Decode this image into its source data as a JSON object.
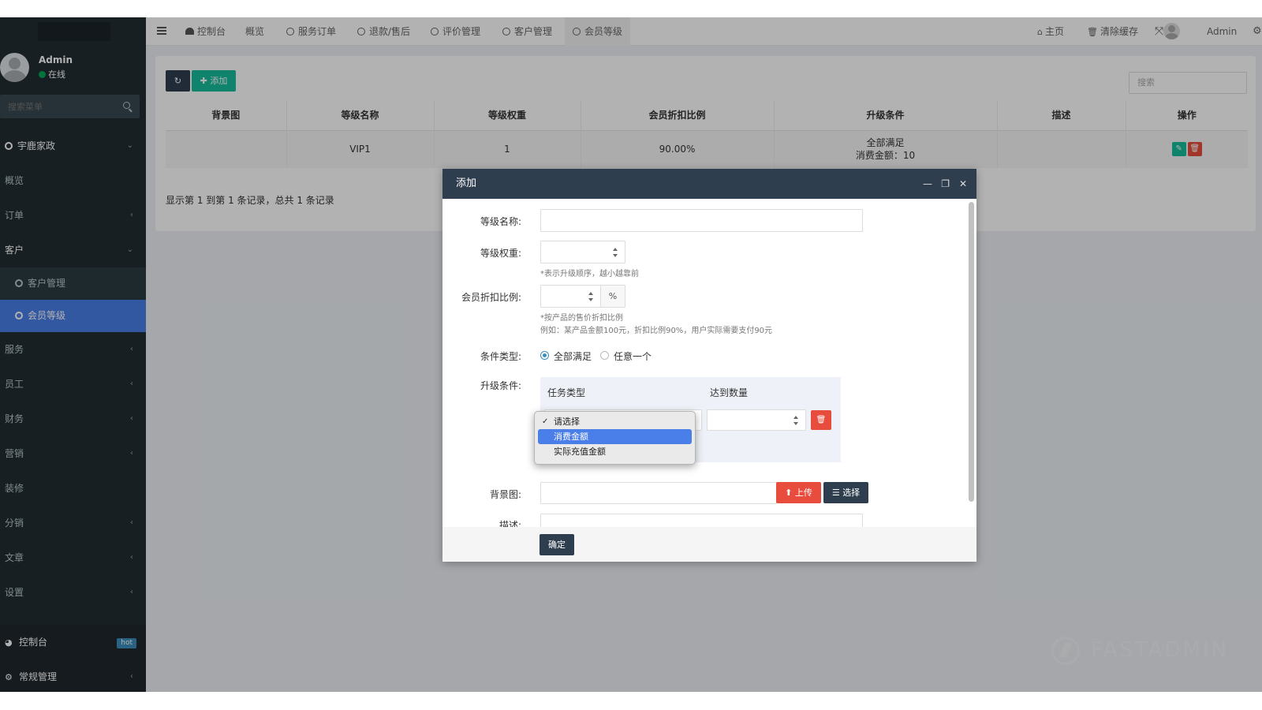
{
  "sidebar": {
    "user": {
      "name": "Admin",
      "status": "在线"
    },
    "search_placeholder": "搜索菜单",
    "menu": [
      {
        "label": "宇鹿家政",
        "chev": "⌄"
      },
      {
        "label": "概览",
        "chev": ""
      },
      {
        "label": "订单",
        "chev": "‹"
      },
      {
        "label": "客户",
        "chev": "⌄"
      },
      {
        "label": "客户管理",
        "chev": ""
      },
      {
        "label": "会员等级",
        "chev": ""
      },
      {
        "label": "服务",
        "chev": "‹"
      },
      {
        "label": "员工",
        "chev": "‹"
      },
      {
        "label": "财务",
        "chev": "‹"
      },
      {
        "label": "营销",
        "chev": "‹"
      },
      {
        "label": "装修",
        "chev": ""
      },
      {
        "label": "分销",
        "chev": "‹"
      },
      {
        "label": "文章",
        "chev": "‹"
      },
      {
        "label": "设置",
        "chev": "‹"
      }
    ],
    "bottom": [
      {
        "label": "控制台",
        "badge": "hot"
      },
      {
        "label": "常规管理",
        "chev": "‹"
      }
    ]
  },
  "navbar": {
    "tabs": [
      "控制台",
      "概览",
      "服务订单",
      "退款/售后",
      "评价管理",
      "客户管理",
      "会员等级"
    ],
    "right": {
      "home": "主页",
      "clear_cache": "清除缓存",
      "user": "Admin"
    }
  },
  "panel": {
    "add_label": "添加",
    "search_placeholder": "搜索",
    "columns": [
      "背景图",
      "等级名称",
      "等级权重",
      "会员折扣比例",
      "升级条件",
      "描述",
      "操作"
    ],
    "rows": [
      {
        "bg": "",
        "name": "VIP1",
        "weight": "1",
        "discount": "90.00%",
        "cond_line1": "全部满足",
        "cond_line2": "消费金额：10",
        "desc": ""
      }
    ],
    "pagination_info": "显示第 1 到第 1 条记录，总共 1 条记录"
  },
  "modal": {
    "title": "添加",
    "fields": {
      "name_label": "等级名称:",
      "weight_label": "等级权重:",
      "weight_hint": "*表示升级顺序，越小越靠前",
      "discount_label": "会员折扣比例:",
      "discount_unit": "%",
      "discount_hint1": "*按产品的售价折扣比例",
      "discount_hint2": "例如：某产品金额100元，折扣比例90%，用户实际需要支付90元",
      "cond_type_label": "条件类型:",
      "cond_type_options": [
        "全部满足",
        "任意一个"
      ],
      "cond_type_selected": "全部满足",
      "upgrade_label": "升级条件:",
      "upgrade_headers": [
        "任务类型",
        "达到数量"
      ],
      "bg_label": "背景图:",
      "upload_label": "上传",
      "choose_label": "选择",
      "desc_label": "描述:"
    },
    "confirm_label": "确定"
  },
  "dropdown": {
    "options": [
      "请选择",
      "消费金额",
      "实际充值金额"
    ],
    "checked": "请选择",
    "highlighted": "消费金额"
  },
  "watermark": "FASTADMIN",
  "colors": {
    "sidebar": "#222d32",
    "active": "#4a7ee8",
    "success": "#18bc9c",
    "danger": "#e74c3c",
    "primary_dark": "#2e3e4f"
  }
}
